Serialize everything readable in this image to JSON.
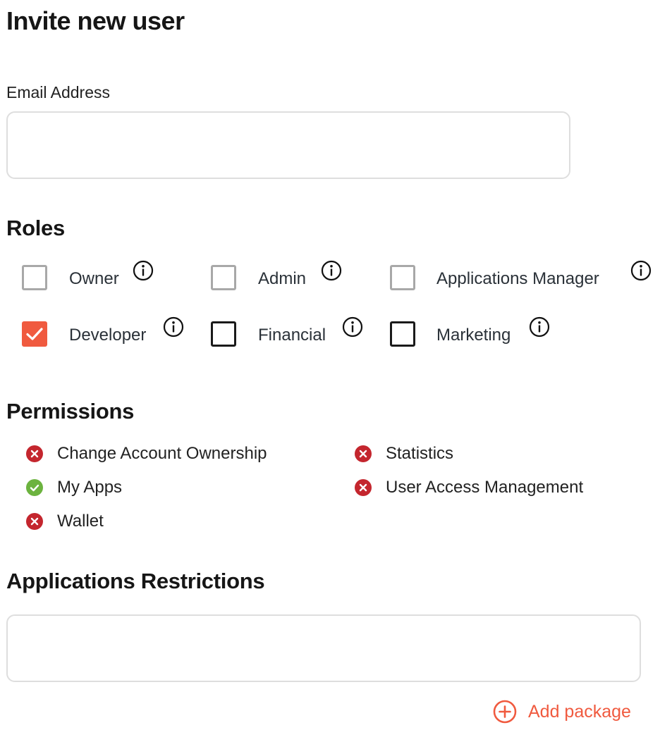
{
  "form": {
    "title": "Invite new user",
    "email": {
      "label": "Email Address",
      "value": "",
      "placeholder": ""
    },
    "roles_heading": "Roles",
    "roles": [
      {
        "label": "Owner",
        "state": "disabled"
      },
      {
        "label": "Admin",
        "state": "disabled"
      },
      {
        "label": "Applications Manager",
        "state": "disabled"
      },
      {
        "label": "Developer",
        "state": "checked"
      },
      {
        "label": "Financial",
        "state": "unchecked"
      },
      {
        "label": "Marketing",
        "state": "unchecked"
      }
    ],
    "permissions_heading": "Permissions",
    "permissions": [
      {
        "label": "Change Account Ownership",
        "granted": false
      },
      {
        "label": "My Apps",
        "granted": true
      },
      {
        "label": "Wallet",
        "granted": false
      },
      {
        "label": "Statistics",
        "granted": false
      },
      {
        "label": "User Access Management",
        "granted": false
      }
    ],
    "restrictions_heading": "Applications Restrictions",
    "restrictions": {
      "value": "",
      "placeholder": ""
    },
    "add_package_label": "Add package"
  },
  "colors": {
    "accent": "#f05a3f",
    "granted": "#6cb33f",
    "denied": "#c4262e",
    "disabled_border": "#a8a8a8"
  }
}
